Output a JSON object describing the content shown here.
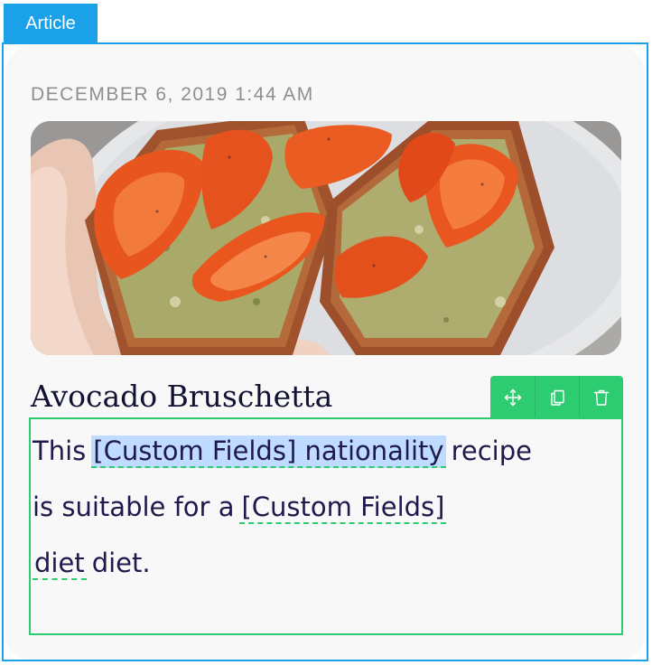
{
  "badge": {
    "label": "Article"
  },
  "post": {
    "date": "DECEMBER 6, 2019 1:44 AM",
    "title": "Avocado Bruschetta",
    "body": {
      "line1_pre": "This",
      "field1": "[Custom Fields] nationality",
      "line1_post": "recipe",
      "line2_pre": "is suitable for a",
      "field2_a": "[Custom Fields]",
      "field2_b": "diet",
      "line3_post": "diet."
    }
  },
  "toolbar": {
    "icons": [
      "move-icon",
      "duplicate-icon",
      "delete-icon"
    ]
  },
  "colors": {
    "editor_blue": "#1aa1e8",
    "editor_green": "#2ecc71",
    "selection": "#bfdbff",
    "text": "#1f1a4d"
  }
}
